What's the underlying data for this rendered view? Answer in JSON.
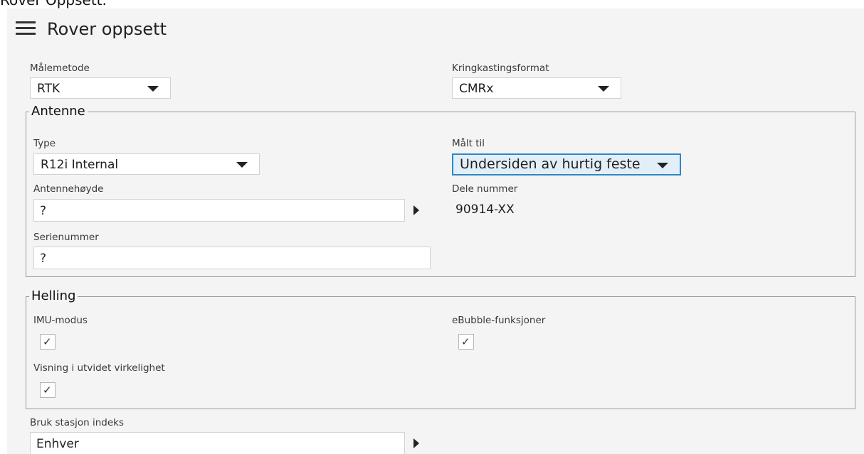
{
  "document_title": "Rover Oppsett.",
  "header": {
    "title": "Rover oppsett"
  },
  "malemetode": {
    "label": "Målemetode",
    "value": "RTK"
  },
  "kringkastingsformat": {
    "label": "Kringkastingsformat",
    "value": "CMRx"
  },
  "antenne": {
    "legend": "Antenne",
    "type": {
      "label": "Type",
      "value": "R12i Internal"
    },
    "malt_til": {
      "label": "Målt til",
      "value": "Undersiden av hurtig feste"
    },
    "antennehoyde": {
      "label": "Antennehøyde",
      "value": "?"
    },
    "dele_nummer": {
      "label": "Dele nummer",
      "value": "90914-XX"
    },
    "serienummer": {
      "label": "Serienummer",
      "value": "?"
    }
  },
  "helling": {
    "legend": "Helling",
    "imu_modus": {
      "label": "IMU-modus",
      "checked": true
    },
    "ebubble": {
      "label": "eBubble-funksjoner",
      "checked": true
    },
    "visning": {
      "label": "Visning i utvidet virkelighet",
      "checked": true
    }
  },
  "bruk_stasjon_indeks": {
    "label": "Bruk stasjon indeks",
    "value": "Enhver"
  },
  "icons": {
    "check": "✓",
    "menu": "hamburger-icon"
  },
  "colors": {
    "focus_border": "#2c86c8",
    "focus_fill": "#e3eff8",
    "panel_bg": "#f4f4f4"
  }
}
